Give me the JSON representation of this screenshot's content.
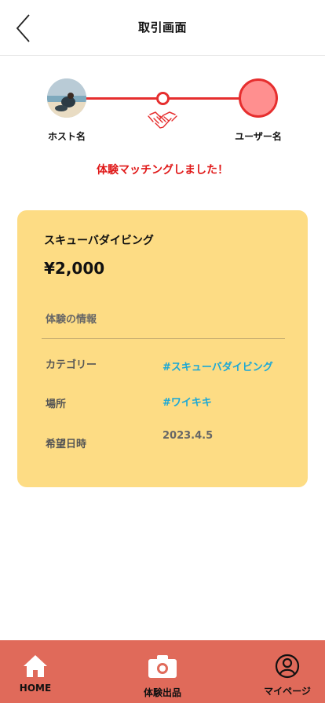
{
  "header": {
    "title": "取引画面",
    "back_icon": "chevron-left-icon"
  },
  "progress": {
    "host_label": "ホスト名",
    "user_label": "ユーザー名",
    "line_color": "#e62e2e",
    "user_color": "#ff8f8f",
    "handshake_icon": "handshake-icon"
  },
  "match_message": "体験マッチングしました！",
  "card": {
    "title": "スキューバダイビング",
    "price": "¥2,000",
    "section_title": "体験の情報",
    "background": "#fddc84",
    "rows": [
      {
        "label": "カテゴリー",
        "value": "#スキューバダイビング"
      },
      {
        "label": "場所",
        "value": "#ワイキキ"
      },
      {
        "label": "希望日時",
        "value": "2023.4.5"
      }
    ]
  },
  "bottom_nav": {
    "background": "#e06a5a",
    "items": [
      {
        "label": "HOME",
        "icon": "home-icon"
      },
      {
        "label": "体験出品",
        "icon": "camera-icon"
      },
      {
        "label": "マイページ",
        "icon": "user-circle-icon"
      }
    ]
  }
}
